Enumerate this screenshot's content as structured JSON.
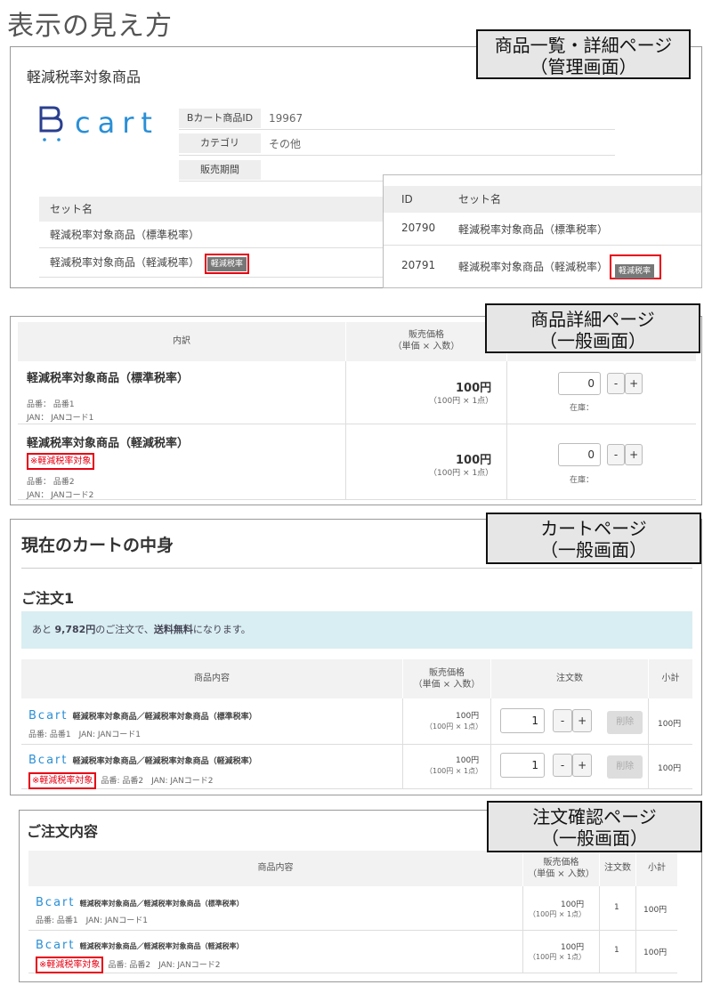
{
  "page_title": "表示の見え方",
  "callouts": {
    "admin": [
      "商品一覧・詳細ページ",
      "（管理画面）"
    ],
    "detail": [
      "商品詳細ページ",
      "（一般画面）"
    ],
    "cart": [
      "カートページ",
      "（一般画面）"
    ],
    "confirm": [
      "注文確認ページ",
      "（一般画面）"
    ]
  },
  "admin": {
    "heading": "軽減税率対象商品",
    "logo_text": "cart",
    "fields": [
      {
        "key": "Bカート商品ID",
        "value": "19967"
      },
      {
        "key": "カテゴリ",
        "value": "その他"
      },
      {
        "key": "販売期間",
        "value": ""
      }
    ],
    "set_header": "セット名",
    "sets": [
      "軽減税率対象商品（標準税率）",
      "軽減税率対象商品（軽減税率）"
    ],
    "badge": "軽減税率",
    "list": {
      "col_id": "ID",
      "col_set": "セット名",
      "rows": [
        {
          "id": "20790",
          "name": "軽減税率対象商品（標準税率）"
        },
        {
          "id": "20791",
          "name": "軽減税率対象商品（軽減税率）"
        }
      ]
    }
  },
  "detail": {
    "col_contents": "内訳",
    "col_price": "販売価格",
    "col_price_sub": "（単価 × 入数）",
    "rows": [
      {
        "name": "軽減税率対象商品（標準税率）",
        "note": "",
        "code": "品番： 品番1",
        "jan": "JAN： JANコード1",
        "price": "100円",
        "price_sub": "（100円 × 1点）",
        "qty": "0",
        "stock": "在庫："
      },
      {
        "name": "軽減税率対象商品（軽減税率）",
        "note": "※軽減税率対象",
        "code": "品番： 品番2",
        "jan": "JAN： JANコード2",
        "price": "100円",
        "price_sub": "（100円 × 1点）",
        "qty": "0",
        "stock": "在庫："
      }
    ],
    "minus": "-",
    "plus": "+"
  },
  "cart": {
    "title": "現在のカートの中身",
    "order_title": "ご注文1",
    "notice_pre": "あと ",
    "notice_amount": "9,782円",
    "notice_mid": "のご注文で、",
    "notice_free": "送料無料",
    "notice_post": "になります。",
    "col_item": "商品内容",
    "col_price": "販売価格",
    "col_price_sub": "（単価 × 入数）",
    "col_qty": "注文数",
    "col_subtotal": "小計",
    "rows": [
      {
        "name": "軽減税率対象商品／軽減税率対象商品（標準税率）",
        "note": "",
        "meta": "品番: 品番1　JAN: JANコード1",
        "price": "100円",
        "price_sub": "（100円 × 1点）",
        "qty": "1",
        "del": "削除",
        "subtotal": "100円"
      },
      {
        "name": "軽減税率対象商品／軽減税率対象商品（軽減税率）",
        "note": "※軽減税率対象",
        "meta": "品番: 品番2　JAN: JANコード2",
        "price": "100円",
        "price_sub": "（100円 × 1点）",
        "qty": "1",
        "del": "削除",
        "subtotal": "100円"
      }
    ]
  },
  "confirm": {
    "title": "ご注文内容",
    "col_item": "商品内容",
    "col_price": "販売価格",
    "col_price_sub": "（単価 × 入数）",
    "col_qty": "注文数",
    "col_subtotal": "小計",
    "rows": [
      {
        "name": "軽減税率対象商品／軽減税率対象商品（標準税率）",
        "note": "",
        "meta": "品番: 品番1　JAN: JANコード1",
        "price": "100円",
        "price_sub": "（100円 × 1点）",
        "qty": "1",
        "subtotal": "100円"
      },
      {
        "name": "軽減税率対象商品／軽減税率対象商品（軽減税率）",
        "note": "※軽減税率対象",
        "meta": "品番: 品番2　JAN: JANコード2",
        "price": "100円",
        "price_sub": "（100円 × 1点）",
        "qty": "1",
        "subtotal": "100円"
      }
    ]
  },
  "colors": {
    "accent_red": "#e60012",
    "logo_blue": "#2a3f8f",
    "notice_bg": "#d9eef2"
  }
}
